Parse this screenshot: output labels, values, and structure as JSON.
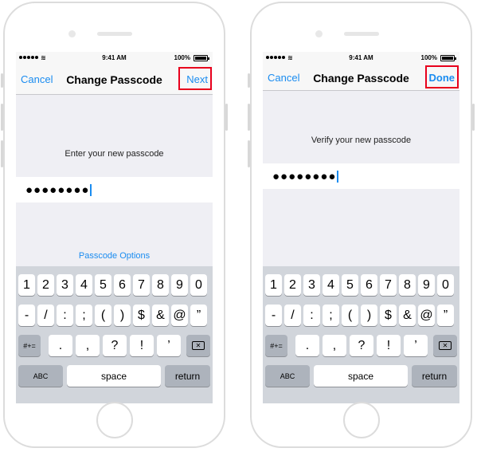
{
  "status_bar": {
    "time": "9:41 AM",
    "battery": "100%"
  },
  "phones": [
    {
      "nav": {
        "cancel": "Cancel",
        "title": "Change Passcode",
        "action": "Next"
      },
      "prompt": "Enter your new passcode",
      "passcode_dots": "●●●●●●●●",
      "options_link": "Passcode Options"
    },
    {
      "nav": {
        "cancel": "Cancel",
        "title": "Change Passcode",
        "action": "Done"
      },
      "prompt": "Verify your new passcode",
      "passcode_dots": "●●●●●●●●"
    }
  ],
  "keyboard": {
    "row1": [
      "1",
      "2",
      "3",
      "4",
      "5",
      "6",
      "7",
      "8",
      "9",
      "0"
    ],
    "row2": [
      "-",
      "/",
      ":",
      ";",
      "(",
      ")",
      "$",
      "&",
      "@",
      "”"
    ],
    "row3_mode": "#+=",
    "row3": [
      ".",
      ",",
      "?",
      "!",
      "’"
    ],
    "abc": "ABC",
    "space": "space",
    "return": "return"
  },
  "colors": {
    "accent": "#1a8cf0",
    "highlight": "#e8001c",
    "background": "#efeff4"
  }
}
